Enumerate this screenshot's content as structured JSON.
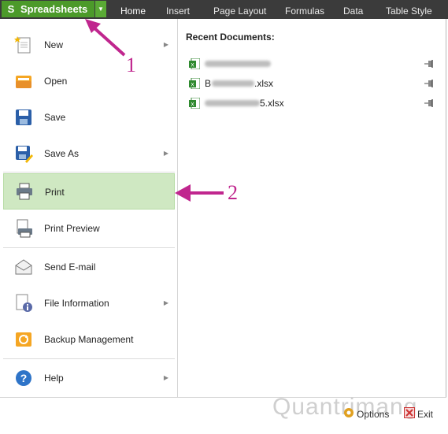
{
  "app": {
    "name": "Spreadsheets",
    "accent": "#4c9a2a"
  },
  "tabs": [
    {
      "label": "Home",
      "active": true
    },
    {
      "label": "Insert"
    },
    {
      "label": "Page Layout"
    },
    {
      "label": "Formulas"
    },
    {
      "label": "Data"
    },
    {
      "label": "Table Style"
    }
  ],
  "menu": [
    {
      "label": "New",
      "icon": "new-document-icon",
      "submenu": true
    },
    {
      "label": "Open",
      "icon": "open-folder-icon"
    },
    {
      "label": "Save",
      "icon": "save-icon"
    },
    {
      "label": "Save As",
      "icon": "save-as-icon",
      "submenu": true
    },
    {
      "label": "Print",
      "icon": "printer-icon",
      "selected": true
    },
    {
      "label": "Print Preview",
      "icon": "print-preview-icon"
    },
    {
      "label": "Send E-mail",
      "icon": "envelope-icon"
    },
    {
      "label": "File Information",
      "icon": "file-info-icon",
      "submenu": true
    },
    {
      "label": "Backup Management",
      "icon": "backup-icon"
    },
    {
      "label": "Help",
      "icon": "help-icon",
      "submenu": true
    }
  ],
  "recent": {
    "title": "Recent Documents:",
    "items": [
      {
        "name": "",
        "icon": "excel-file-icon"
      },
      {
        "name_prefix": "B",
        "name_suffix": ".xlsx",
        "icon": "excel-file-icon"
      },
      {
        "name_prefix": "",
        "name_suffix": "5.xlsx",
        "icon": "excel-file-icon"
      }
    ]
  },
  "footer": {
    "options": "Options",
    "exit": "Exit"
  },
  "annotations": {
    "step1": "1",
    "step2": "2",
    "color": "#c0268e"
  },
  "watermark": "Quantrimang"
}
